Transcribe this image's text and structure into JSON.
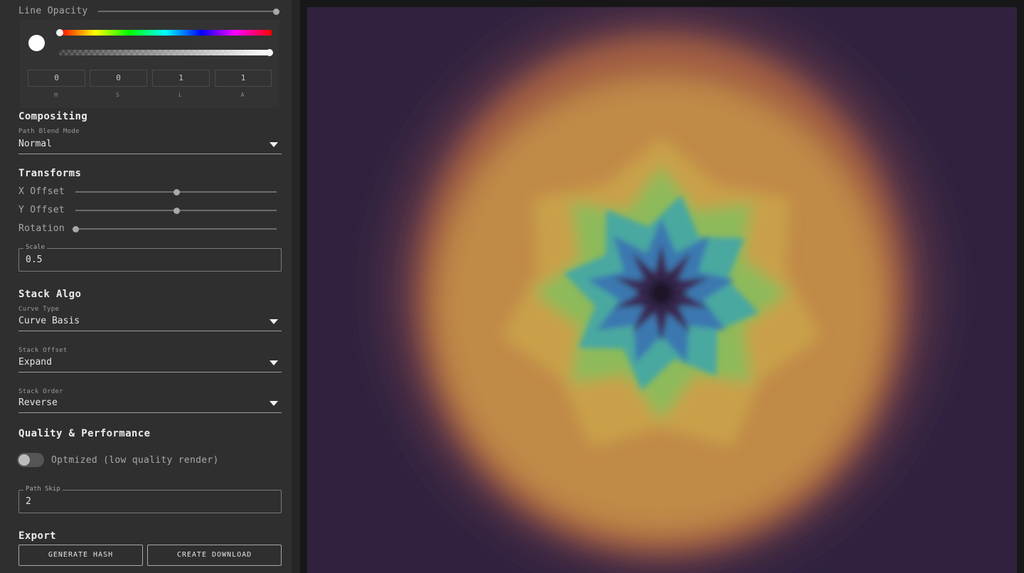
{
  "line_opacity": {
    "label": "Line Opacity",
    "value": 1
  },
  "color_picker": {
    "swatch_color": "#ffffff",
    "hue": 0,
    "alpha": 1,
    "fields": [
      {
        "label": "H",
        "value": "0"
      },
      {
        "label": "S",
        "value": "0"
      },
      {
        "label": "L",
        "value": "1"
      },
      {
        "label": "A",
        "value": "1"
      }
    ]
  },
  "compositing": {
    "title": "Compositing",
    "path_blend_mode": {
      "label": "Path Blend Mode",
      "value": "Normal"
    }
  },
  "transforms": {
    "title": "Transforms",
    "x_offset": {
      "label": "X Offset",
      "value": 0.5
    },
    "y_offset": {
      "label": "Y Offset",
      "value": 0.5
    },
    "rotation": {
      "label": "Rotation",
      "value": 0
    },
    "scale": {
      "label": "Scale",
      "value": "0.5"
    }
  },
  "stack_algo": {
    "title": "Stack Algo",
    "curve_type": {
      "label": "Curve Type",
      "value": "Curve Basis"
    },
    "stack_offset": {
      "label": "Stack Offset",
      "value": "Expand"
    },
    "stack_order": {
      "label": "Stack Order",
      "value": "Reverse"
    }
  },
  "quality": {
    "title": "Quality & Performance",
    "optimized": {
      "label": "Optmized (low quality render)",
      "on": false
    },
    "path_skip": {
      "label": "Path Skip",
      "value": "2"
    }
  },
  "export": {
    "title": "Export",
    "generate_hash_label": "GENERATE HASH",
    "create_download_label": "CREATE DOWNLOAD"
  },
  "colors": {
    "canvas_background": "#30223f",
    "panel_background": "#2f2f2f"
  }
}
